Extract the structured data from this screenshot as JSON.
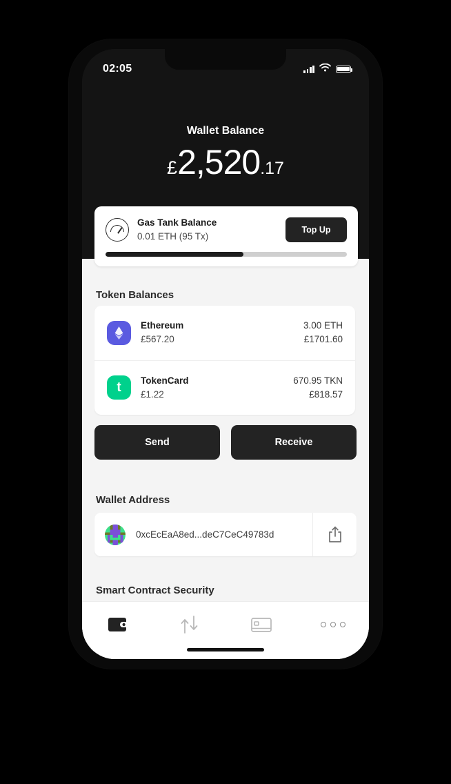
{
  "status_bar": {
    "time": "02:05",
    "signal_icon": "signal-bars-icon",
    "wifi_icon": "wifi-icon",
    "battery_icon": "battery-full-icon"
  },
  "header": {
    "balance_label": "Wallet Balance",
    "currency_symbol": "£",
    "balance_integer": "2,520",
    "balance_decimal": ".17",
    "background_color": "#141414"
  },
  "gas_tank": {
    "icon": "gauge-icon",
    "title": "Gas Tank Balance",
    "subtitle": "0.01 ETH (95 Tx)",
    "top_up_label": "Top Up",
    "progress_percent": 57,
    "fill_color": "#1d1d1d",
    "track_color": "#cfcfcf"
  },
  "token_balances": {
    "title": "Token Balances",
    "tokens": [
      {
        "icon": "ethereum-icon",
        "icon_color": "#5A5AE0",
        "name": "Ethereum",
        "price": "£567.20",
        "amount": "3.00 ETH",
        "fiat": "£1701.60"
      },
      {
        "icon": "tokencard-icon",
        "icon_color": "#00D18C",
        "glyph": "t",
        "name": "TokenCard",
        "price": "£1.22",
        "amount": "670.95 TKN",
        "fiat": "£818.57"
      }
    ]
  },
  "actions": {
    "send_label": "Send",
    "receive_label": "Receive",
    "button_color": "#232323"
  },
  "wallet_address": {
    "title": "Wallet Address",
    "identicon": "blockie-identicon",
    "address": "0xcEcEaA8ed...deC7CeC49783d",
    "share_icon": "share-icon"
  },
  "smart_contract": {
    "title": "Smart Contract Security"
  },
  "tab_bar": {
    "tabs": [
      {
        "icon": "wallet-icon",
        "active": true
      },
      {
        "icon": "transfer-arrows-icon",
        "active": false
      },
      {
        "icon": "card-icon",
        "active": false
      },
      {
        "icon": "more-dots-icon",
        "active": false
      }
    ]
  }
}
